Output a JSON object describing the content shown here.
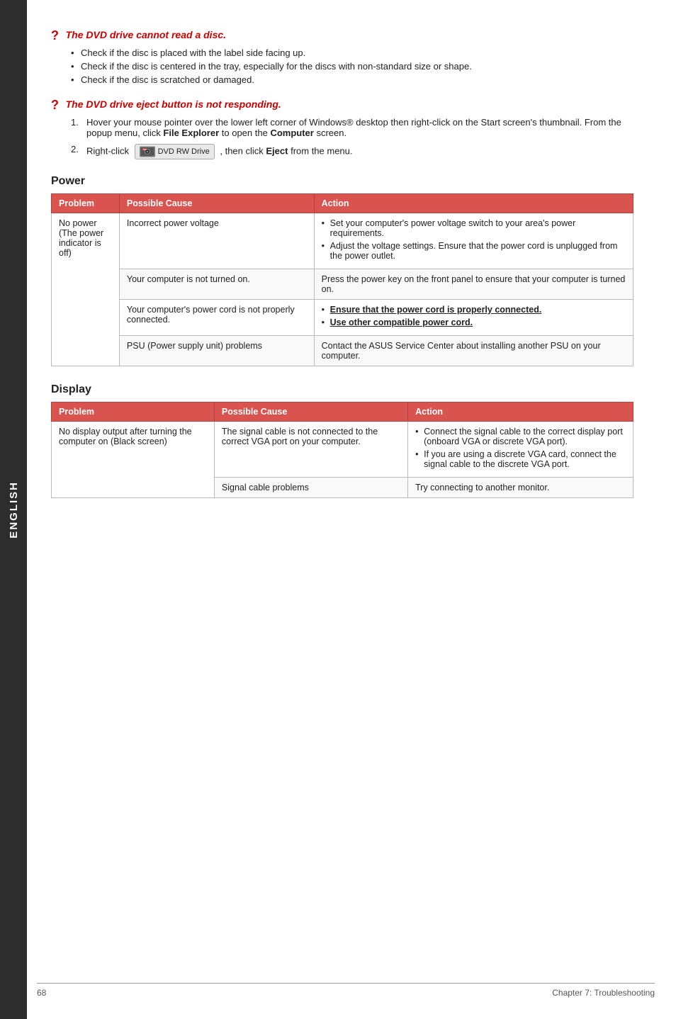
{
  "sidebar": {
    "label": "ENGLISH"
  },
  "dvd_section": {
    "q1": {
      "icon": "?",
      "title": "The DVD drive cannot read a disc.",
      "bullets": [
        "Check if the disc is placed with the label side facing up.",
        "Check if the disc is centered in the tray, especially for the discs with non-standard size or shape.",
        "Check if the disc is scratched or damaged."
      ]
    },
    "q2": {
      "icon": "?",
      "title": "The DVD drive eject button is not responding.",
      "steps": [
        "Hover your mouse pointer over the lower left corner of Windows® desktop then right-click on the Start screen's thumbnail. From the popup menu, click File Explorer to open the Computer screen.",
        "Right-click  DVD RW Drive , then click Eject from the menu."
      ],
      "step2_prefix": "Right-click",
      "step2_drive": "DVD RW Drive",
      "step2_suffix": ", then click",
      "step2_eject": "Eject",
      "step2_end": "from the menu."
    }
  },
  "power_section": {
    "title": "Power",
    "headers": [
      "Problem",
      "Possible Cause",
      "Action"
    ],
    "rows": [
      {
        "problem": "No power\n(The power\nindicator is off)",
        "possible_cause": "Incorrect power voltage",
        "action_bullets": [
          "Set your computer's power voltage switch to your area's power requirements.",
          "Adjust the voltage settings. Ensure that the power cord is unplugged from the power outlet."
        ],
        "action_type": "bullets",
        "rowspan": 4
      },
      {
        "possible_cause": "Your computer is not turned on.",
        "action_text": "Press the power key on the front panel to ensure that your computer is turned on.",
        "action_type": "text"
      },
      {
        "possible_cause": "Your computer's power cord is not properly connected.",
        "action_bullets": [
          "Ensure that the power cord is properly connected.",
          "Use other compatible power cord."
        ],
        "action_type": "bullets_bold_first"
      },
      {
        "possible_cause": "PSU (Power supply unit) problems",
        "action_text": "Contact the ASUS Service Center about installing another PSU on your computer.",
        "action_type": "text"
      }
    ]
  },
  "display_section": {
    "title": "Display",
    "headers": [
      "Problem",
      "Possible Cause",
      "Action"
    ],
    "rows": [
      {
        "problem": "No display output after turning the computer on (Black screen)",
        "possible_cause": "The signal cable is not connected to the correct VGA port on your computer.",
        "action_bullets": [
          "Connect the signal cable to the correct display port (onboard VGA or discrete VGA port).",
          "If you are using a discrete VGA card, connect the signal cable to the discrete VGA port."
        ],
        "action_type": "bullets_bold_second",
        "rowspan": 2
      },
      {
        "possible_cause": "Signal cable problems",
        "action_text": "Try connecting to another monitor.",
        "action_type": "text"
      }
    ]
  },
  "footer": {
    "page_number": "68",
    "chapter": "Chapter 7: Troubleshooting"
  }
}
